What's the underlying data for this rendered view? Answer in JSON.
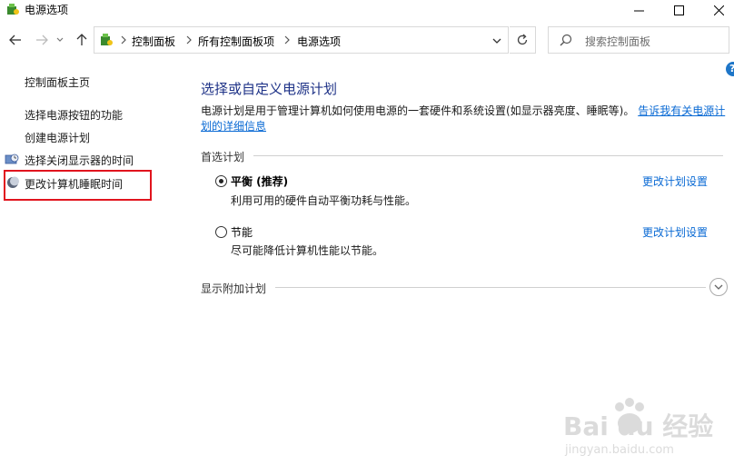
{
  "window": {
    "title": "电源选项"
  },
  "address_bar": {
    "crumbs": [
      "控制面板",
      "所有控制面板项",
      "电源选项"
    ]
  },
  "search": {
    "placeholder": "搜索控制面板"
  },
  "left_pane": {
    "home": "控制面板主页",
    "links": [
      "选择电源按钮的功能",
      "创建电源计划",
      "选择关闭显示器的时间",
      "更改计算机睡眠时间"
    ]
  },
  "main": {
    "title": "选择或自定义电源计划",
    "description": "电源计划是用于管理计算机如何使用电源的一套硬件和系统设置(如显示器亮度、睡眠等)。",
    "description_link": "告诉我有关电源计划的详细信息",
    "preferred_section": "首选计划",
    "plans": [
      {
        "name": "平衡 (推荐)",
        "desc": "利用可用的硬件自动平衡功耗与性能。",
        "link": "更改计划设置",
        "selected": true
      },
      {
        "name": "节能",
        "desc": "尽可能降低计算机性能以节能。",
        "link": "更改计划设置",
        "selected": false
      }
    ],
    "additional_section": "显示附加计划"
  },
  "watermark": {
    "brand": "Bai du 经验",
    "url": "jingyan.baidu.com"
  },
  "colors": {
    "title_blue": "#1e3287",
    "link_blue": "#0a6ad4",
    "highlight_red": "#e1141e"
  }
}
